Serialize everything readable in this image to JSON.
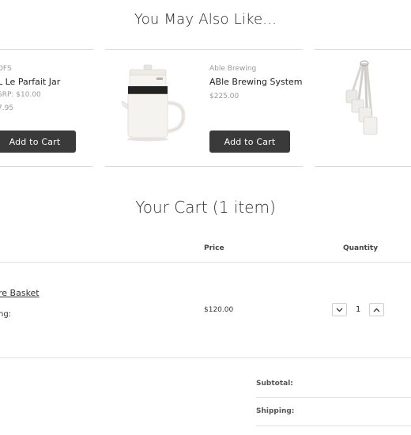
{
  "recommendations": {
    "title": "You May Also Like...",
    "items": [
      {
        "brand": "DFS",
        "name": "L Le Parfait Jar",
        "price": "SRP: $10.00",
        "price2": "7.95",
        "button": "Add to Cart"
      },
      {
        "brand": "Able Brewing",
        "name": "ABle Brewing System",
        "price": "$225.00",
        "button": "Add to Cart"
      }
    ]
  },
  "cart": {
    "title": "Your Cart (1 item)",
    "headers": {
      "price": "Price",
      "quantity": "Quantity"
    },
    "item": {
      "name": "re Basket",
      "option": "ng:",
      "price": "$120.00",
      "quantity": "1"
    }
  },
  "summary": {
    "subtotal_label": "Subtotal:",
    "shipping_label": "Shipping:"
  }
}
